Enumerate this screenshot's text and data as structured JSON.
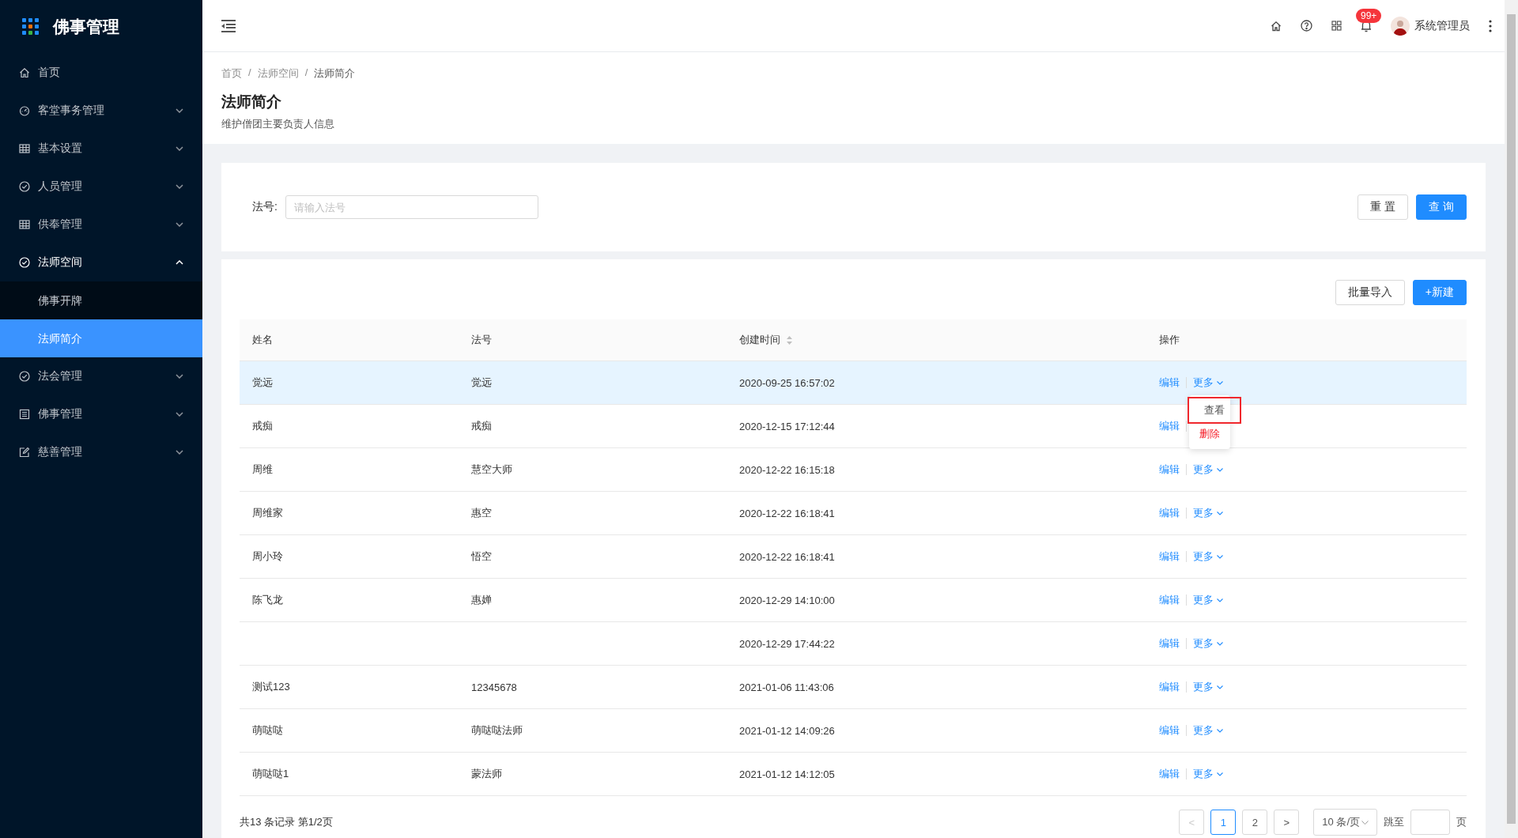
{
  "app": {
    "title": "佛事管理"
  },
  "sidebar": {
    "items": [
      {
        "label": "首页",
        "kind": "link",
        "expanded": false
      },
      {
        "label": "客堂事务管理",
        "kind": "group",
        "expanded": false
      },
      {
        "label": "基本设置",
        "kind": "group",
        "expanded": false
      },
      {
        "label": "人员管理",
        "kind": "group",
        "expanded": false
      },
      {
        "label": "供奉管理",
        "kind": "group",
        "expanded": false
      },
      {
        "label": "法师空间",
        "kind": "group",
        "expanded": true,
        "children": [
          {
            "label": "佛事开牌",
            "selected": false
          },
          {
            "label": "法师简介",
            "selected": true
          }
        ]
      },
      {
        "label": "法会管理",
        "kind": "group",
        "expanded": false
      },
      {
        "label": "佛事管理",
        "kind": "group",
        "expanded": false
      },
      {
        "label": "慈善管理",
        "kind": "group",
        "expanded": false
      }
    ]
  },
  "header": {
    "badge": "99+",
    "user": "系统管理员"
  },
  "breadcrumb": [
    {
      "label": "首页"
    },
    {
      "separator": "/",
      "label": "法师空间"
    },
    {
      "separator": "/",
      "label": "法师简介"
    }
  ],
  "page": {
    "title": "法师简介",
    "subtitle": "维护僧团主要负责人信息"
  },
  "search": {
    "label": "法号:",
    "placeholder": "请输入法号",
    "buttons": [
      "重 置",
      "查 询"
    ]
  },
  "toolbar": {
    "buttons": [
      "批量导入",
      "+新建"
    ]
  },
  "table": {
    "columns": [
      "姓名",
      "法号",
      "创建时间",
      "操作"
    ],
    "rows": [
      {
        "name": "觉远",
        "dharma_name": "觉远",
        "created": "2020-09-25 16:57:02",
        "hovered": true,
        "edit": "编辑",
        "more": "更多"
      },
      {
        "name": "戒痴",
        "dharma_name": "戒痴",
        "created": "2020-12-15 17:12:44",
        "hovered": false,
        "edit": "编辑"
      },
      {
        "name": "周维",
        "dharma_name": "慧空大师",
        "created": "2020-12-22 16:15:18",
        "hovered": false,
        "edit": "编辑",
        "more": "更多"
      },
      {
        "name": "周维家",
        "dharma_name": "惠空",
        "created": "2020-12-22 16:18:41",
        "hovered": false,
        "edit": "编辑",
        "more": "更多"
      },
      {
        "name": "周小玲",
        "dharma_name": "悟空",
        "created": "2020-12-22 16:18:41",
        "hovered": false,
        "edit": "编辑",
        "more": "更多"
      },
      {
        "name": "陈飞龙",
        "dharma_name": "惠婵",
        "created": "2020-12-29 14:10:00",
        "hovered": false,
        "edit": "编辑",
        "more": "更多"
      },
      {
        "created": "2020-12-29 17:44:22",
        "hovered": false,
        "edit": "编辑",
        "more": "更多"
      },
      {
        "name": "测试123",
        "dharma_name": "12345678",
        "created": "2021-01-06 11:43:06",
        "hovered": false,
        "edit": "编辑",
        "more": "更多"
      },
      {
        "name": "萌哒哒",
        "dharma_name": "萌哒哒法师",
        "created": "2021-01-12 14:09:26",
        "hovered": false,
        "edit": "编辑",
        "more": "更多"
      },
      {
        "name": "萌哒哒1",
        "dharma_name": "蒙法师",
        "created": "2021-01-12 14:12:05",
        "hovered": false,
        "edit": "编辑",
        "more": "更多"
      }
    ]
  },
  "dropdown": {
    "items": [
      {
        "label": "查看",
        "kind": "normal",
        "highlighted": true
      },
      {
        "label": "删除",
        "kind": "danger",
        "highlighted": false
      }
    ]
  },
  "pagination": {
    "summary": "共13 条记录 第1/2页",
    "prev": "<",
    "next": ">",
    "pages": [
      {
        "label": "1",
        "selected": true
      },
      {
        "label": "2",
        "selected": false
      }
    ],
    "page_size": "10 条/页",
    "jump_label": "跳至",
    "jump_suffix": "页"
  }
}
